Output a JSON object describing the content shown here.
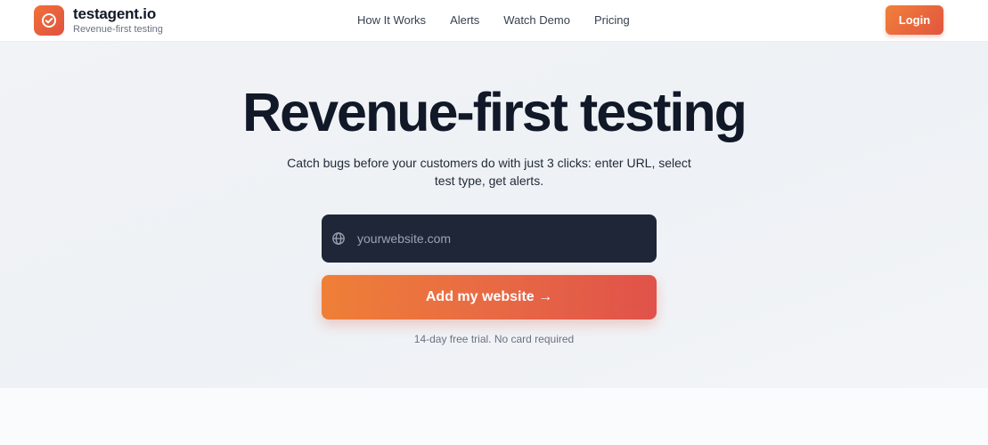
{
  "brand": {
    "name": "testagent.io",
    "tagline": "Revenue-first testing",
    "accent_color": "#ec6a3e",
    "logo_icon": "check-circle-icon"
  },
  "nav": {
    "items": [
      {
        "label": "How It Works"
      },
      {
        "label": "Alerts"
      },
      {
        "label": "Watch Demo"
      },
      {
        "label": "Pricing"
      }
    ],
    "login_label": "Login"
  },
  "hero": {
    "title": "Revenue-first testing",
    "subtitle": "Catch bugs before your customers do with just 3 clicks: enter URL, select test type, get alerts.",
    "url_input": {
      "placeholder": "yourwebsite.com",
      "value": "",
      "icon": "globe-icon"
    },
    "cta_label": "Add my website →",
    "trial_note": "14-day free trial. No card required"
  },
  "colors": {
    "input_bg": "#1f2638",
    "cta_gradient_start": "#ef7f37",
    "cta_gradient_end": "#e0524a"
  }
}
